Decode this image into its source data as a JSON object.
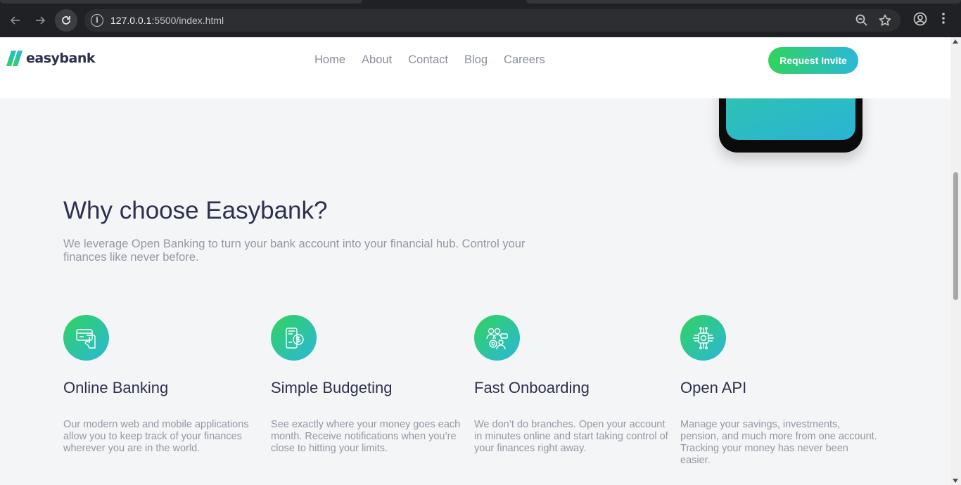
{
  "browser": {
    "url_host": "127.0.0.1",
    "url_rest": ":5500/index.html",
    "icons": [
      "back-arrow-icon",
      "forward-arrow-icon",
      "reload-icon",
      "site-info-icon",
      "zoom-icon",
      "bookmark-star-icon",
      "profile-icon",
      "menu-kebab-icon"
    ]
  },
  "header": {
    "logo_text": "easybank",
    "nav": [
      "Home",
      "About",
      "Contact",
      "Blog",
      "Careers"
    ],
    "cta_label": "Request Invite"
  },
  "why": {
    "title": "Why choose Easybank?",
    "subtitle": "We leverage Open Banking to turn your bank account into your financial hub. Control your finances like never before."
  },
  "features": [
    {
      "icon": "online-banking-icon",
      "title": "Online Banking",
      "text": "Our modern web and mobile applications allow you to keep track of your finances wherever you are in the world."
    },
    {
      "icon": "budgeting-icon",
      "title": "Simple Budgeting",
      "text": "See exactly where your money goes each month. Receive notifications when you’re close to hitting your limits."
    },
    {
      "icon": "onboarding-icon",
      "title": "Fast Onboarding",
      "text": "We don’t do branches. Open your account in minutes online and start taking control of your finances right away."
    },
    {
      "icon": "api-icon",
      "title": "Open API",
      "text": "Manage your savings, investments, pension, and much more from one account. Tracking your money has never been easier."
    }
  ],
  "colors": {
    "brand_dark": "#2d314d",
    "lime": "#31d35c",
    "cyan": "#2bb7da",
    "grey_text": "#9597a3",
    "page_bg": "#f4f5f7"
  }
}
